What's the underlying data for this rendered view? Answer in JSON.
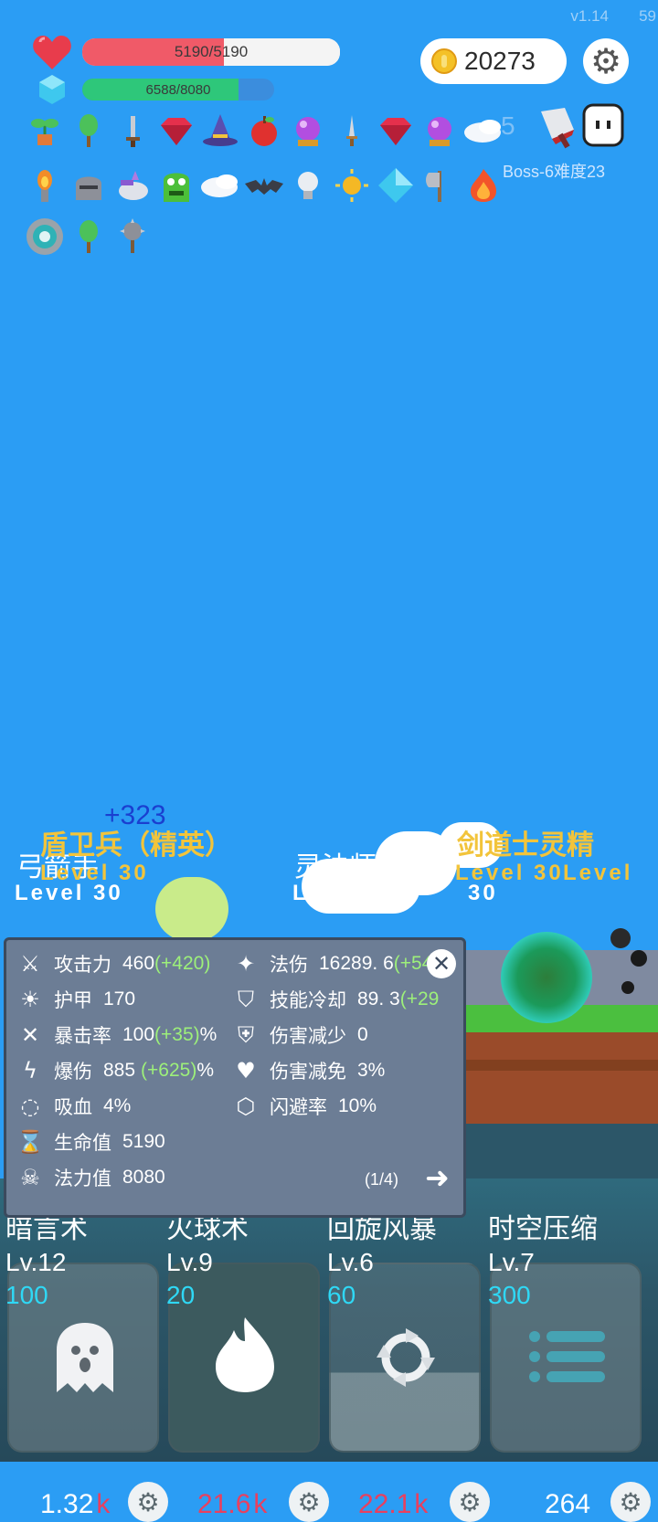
{
  "header": {
    "version": "v1.14",
    "fps": "59"
  },
  "player": {
    "hp_text": "5190/5190",
    "hp_fraction": 1.0,
    "mp_text": "6588/8080",
    "mp_fraction": 0.815
  },
  "currency": {
    "coins": "20273"
  },
  "colors": {
    "hp": "#f0596a",
    "mp": "#2ec77a",
    "bonus": "#9df07a",
    "mana_cost": "#2fd8f5",
    "damage": "#e8405f",
    "elite": "#f2c43b"
  },
  "items_row1": [
    "sapling-pot-icon",
    "tree-icon",
    "sword-icon",
    "ruby-icon",
    "wizard-hat-icon",
    "apple-icon",
    "crystal-ball-icon",
    "dagger-icon",
    "ruby-icon",
    "crystal-ball-icon",
    "wing-icon"
  ],
  "items_row2": [
    "torch-icon",
    "knight-helmet-icon",
    "unicorn-icon",
    "green-monster-icon",
    "wing-icon",
    "bat-icon",
    "lightbulb-icon",
    "sun-icon",
    "diamond-icon",
    "axe-icon",
    "fire-icon"
  ],
  "items_row3": [
    "shield-ring-icon",
    "tree-icon",
    "spiked-mace-icon"
  ],
  "boss": {
    "label": "Boss-6难度23",
    "faded_number": "5"
  },
  "scene": {
    "float_number": "+323",
    "units": [
      {
        "name": "弓箭手",
        "level": "Level 30"
      },
      {
        "name": "盾卫兵（精英）",
        "level": "Level 30"
      },
      {
        "name": "灵法师",
        "name_tail": "手",
        "level": "Level",
        "level_tail": "30"
      },
      {
        "name": "剑道士灵精",
        "level": "Level 30",
        "overlap": "Level"
      }
    ]
  },
  "stats_panel": {
    "page": "(1/4)",
    "left": [
      {
        "icon": "axe-icon",
        "label": "攻击力",
        "value": "460",
        "bonus": "(+420)"
      },
      {
        "icon": "sun-icon",
        "label": "护甲",
        "value": "170"
      },
      {
        "icon": "crosshair-icon",
        "label": "暴击率",
        "value": "100",
        "bonus": "(+35)",
        "unit": "%"
      },
      {
        "icon": "lightning-icon",
        "label": "爆伤",
        "value": "885",
        "bonus": "(+625)",
        "unit": "%"
      },
      {
        "icon": "lifesteal-icon",
        "label": "吸血",
        "value": "4%"
      },
      {
        "icon": "hourglass-icon",
        "label": "生命值",
        "value": "5190"
      },
      {
        "icon": "skull-icon",
        "label": "法力值",
        "value": "8080"
      }
    ],
    "right": [
      {
        "icon": "magic-wand-icon",
        "label": "法伤",
        "value": "16289. 6",
        "bonus": "(+54"
      },
      {
        "icon": "shield-icon",
        "label": "技能冷却",
        "value": "89. 3",
        "bonus": "(+29"
      },
      {
        "icon": "heart-shield-icon",
        "label": "伤害减少",
        "value": "0"
      },
      {
        "icon": "heart-icon",
        "label": "伤害减免",
        "value": "3%"
      },
      {
        "icon": "hexagon-gem-icon",
        "label": "闪避率",
        "value": "10%"
      }
    ]
  },
  "skills": [
    {
      "name": "暗言术",
      "level": "Lv.12",
      "cost": "100",
      "dmg_num": "1.32",
      "dmg_unit": "k",
      "icon": "ghost-icon"
    },
    {
      "name": "火球术",
      "level": "Lv.9",
      "cost": "20",
      "dmg_num": "21.6",
      "dmg_unit": "k",
      "icon": "fireball-icon"
    },
    {
      "name": "回旋风暴",
      "level": "Lv.6",
      "cost": "60",
      "dmg_num": "22.1",
      "dmg_unit": "k",
      "icon": "whirlwind-icon"
    },
    {
      "name": "时空压缩",
      "level": "Lv.7",
      "cost": "300",
      "dmg_num": "264",
      "dmg_unit": "",
      "icon": "list-icon"
    }
  ]
}
